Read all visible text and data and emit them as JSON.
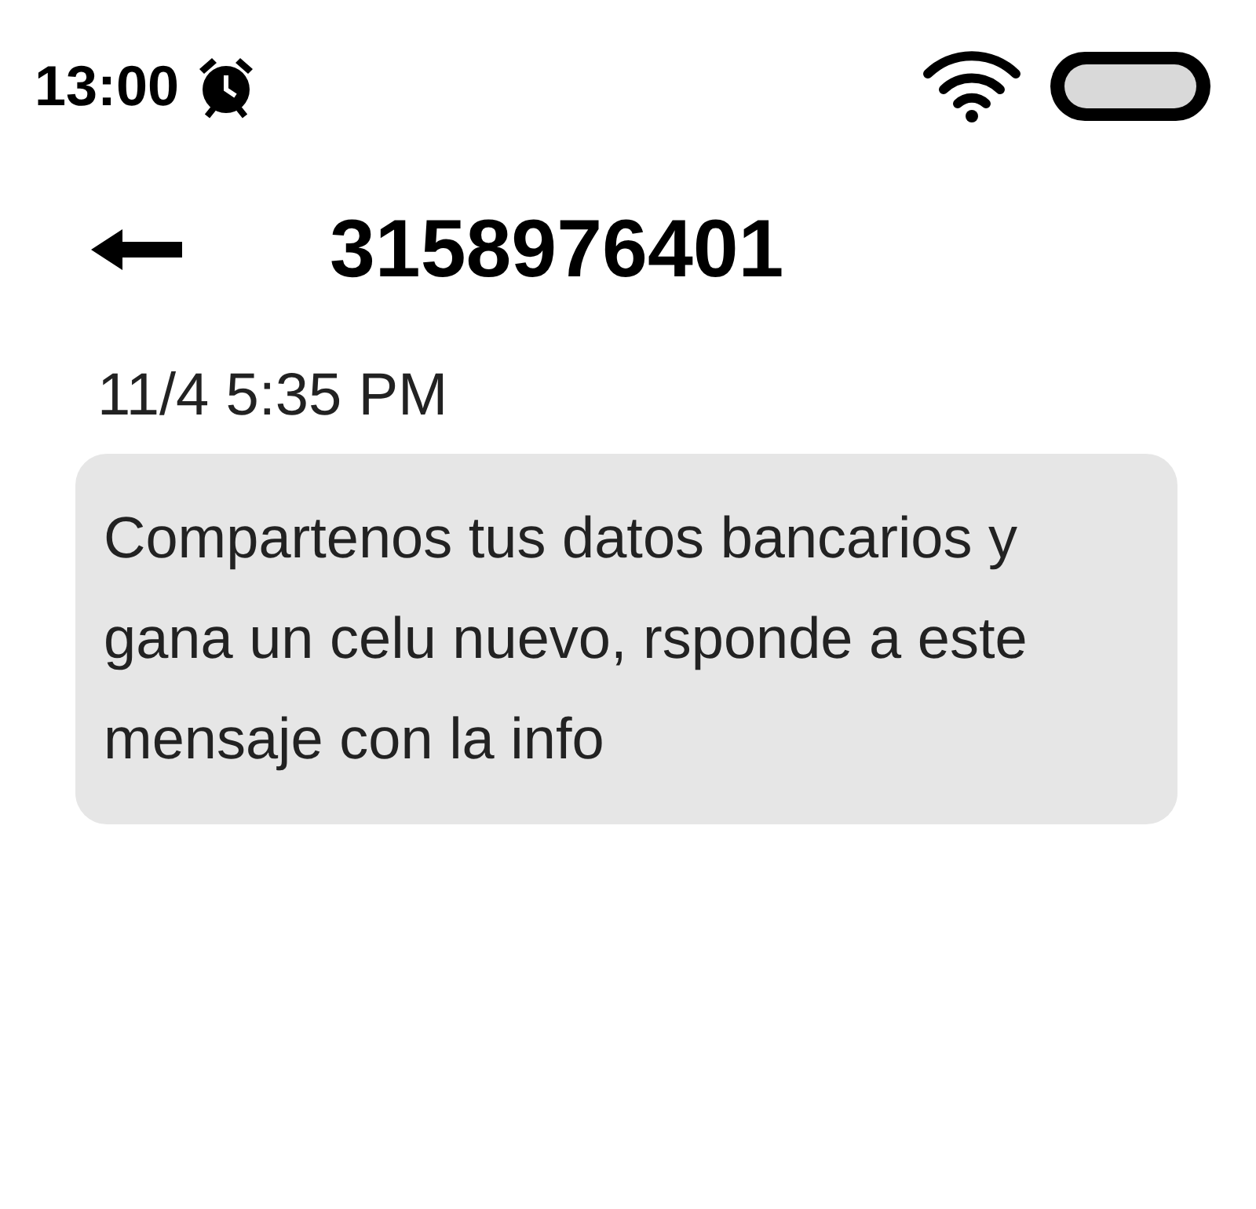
{
  "status_bar": {
    "time": "13:00"
  },
  "header": {
    "title": "3158976401"
  },
  "message": {
    "timestamp": "11/4 5:35 PM",
    "text": "Compartenos tus datos bancarios y gana un celu nuevo, rsponde a este mensaje con la info"
  }
}
